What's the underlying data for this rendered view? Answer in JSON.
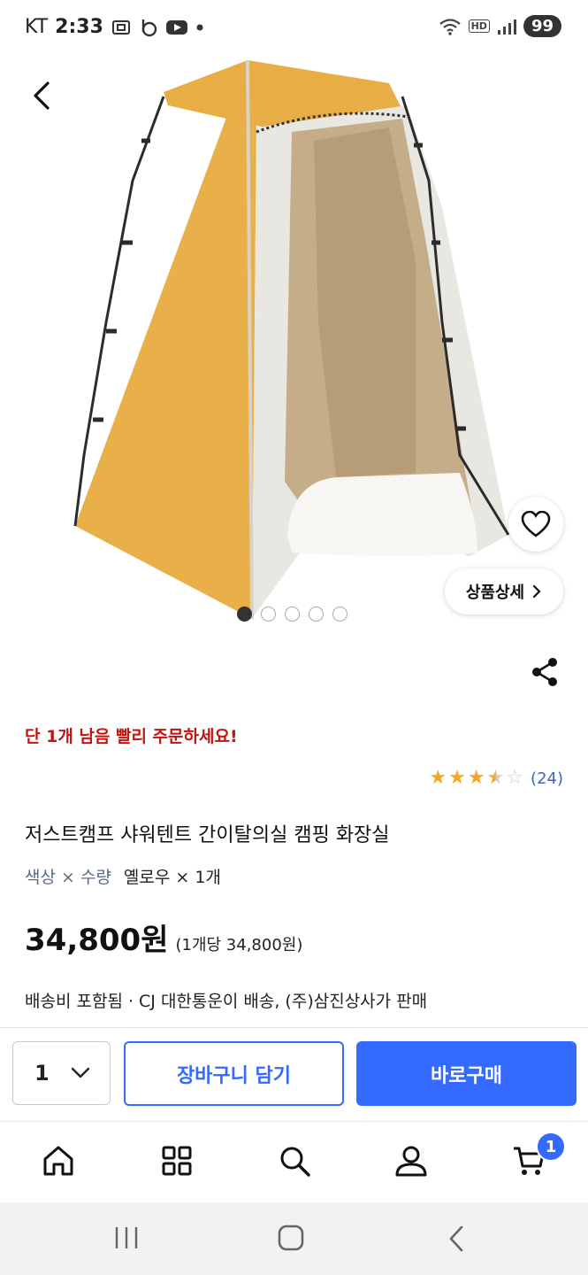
{
  "status_bar": {
    "carrier": "KT",
    "time": "2:33",
    "battery": "99",
    "hd": "HD"
  },
  "hero": {
    "image_count": 5,
    "active_index": 0,
    "detail_label": "상품상세"
  },
  "product": {
    "urgency": "단 1개 남음 빨리 주문하세요!",
    "rating": 3.5,
    "review_count": "(24)",
    "title": "저스트캠프 샤워텐트 간이탈의실 캠핑 화장실",
    "option_label": "색상 × 수량",
    "option_value": "옐로우 × 1개",
    "price": "34,800원",
    "unit_price": "(1개당 34,800원)",
    "shipping": "배송비 포함됨 ·  CJ 대한통운이 배송, (주)삼진상사가 판매"
  },
  "action_bar": {
    "quantity": "1",
    "cart_label": "장바구니 담기",
    "buy_label": "바로구매"
  },
  "bottom_nav": {
    "items": [
      "home-icon",
      "category-icon",
      "search-icon",
      "user-icon",
      "cart-icon"
    ],
    "cart_badge": "1"
  },
  "colors": {
    "accent": "#346aff",
    "urgency": "#c0160f",
    "star": "#f5a623",
    "tent_yellow": "#e9b04a"
  }
}
